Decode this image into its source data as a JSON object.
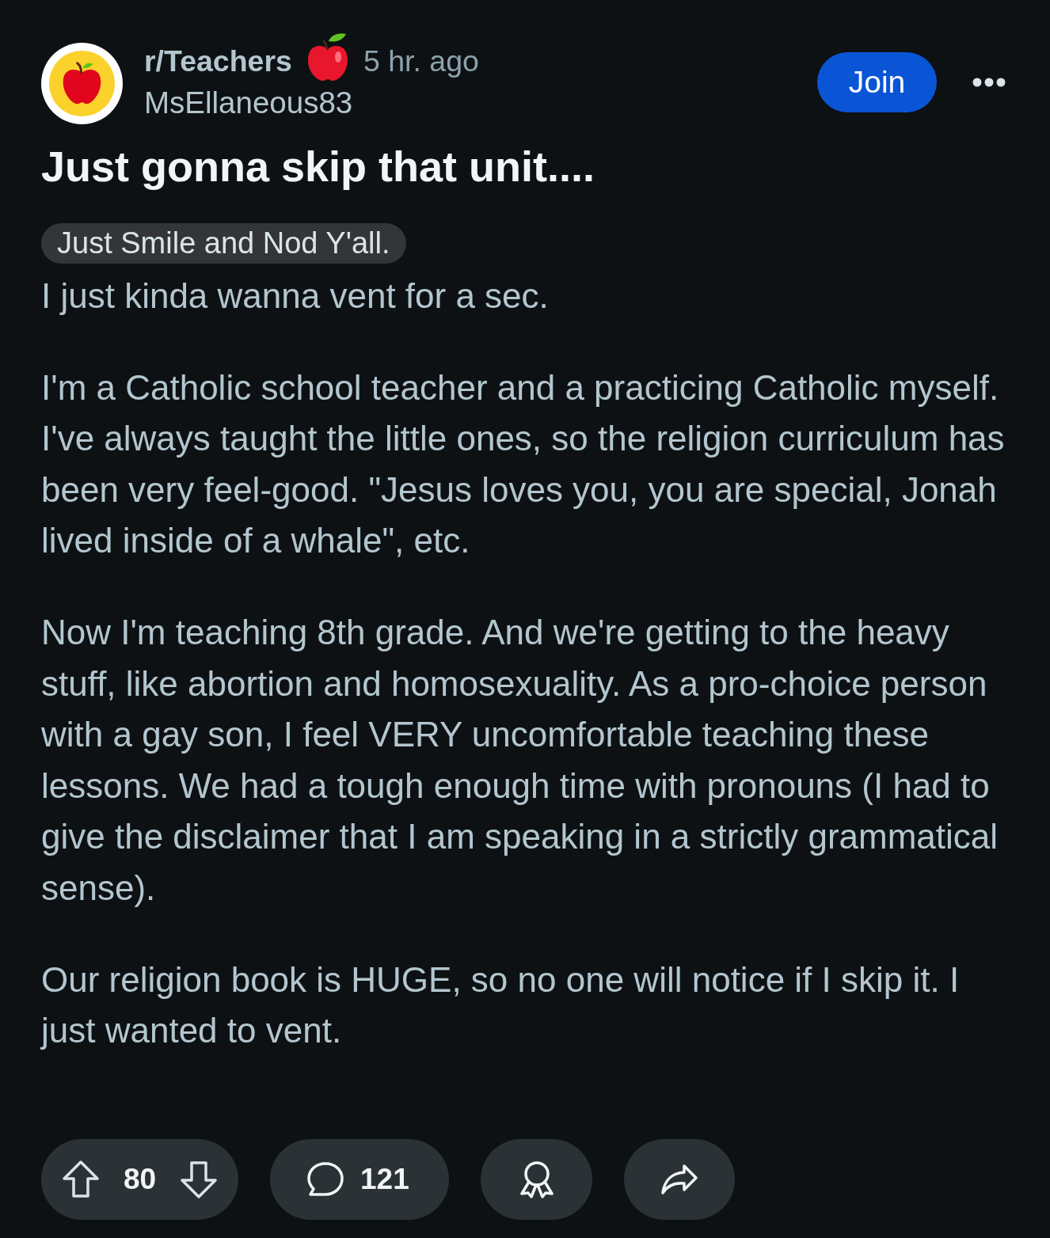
{
  "post": {
    "subreddit": "r/Teachers",
    "time": "5 hr. ago",
    "author": "MsEllaneous83",
    "join_button": "Join",
    "title": "Just gonna skip that unit....",
    "flair": "Just Smile and Nod Y'all.",
    "body": [
      "I just kinda wanna vent for a sec.",
      "I'm a Catholic school teacher and a practicing Catholic myself. I've always taught the little ones, so the religion curriculum has been very feel-good. \"Jesus loves you, you are special, Jonah lived inside of a whale\", etc.",
      "Now I'm teaching 8th grade. And we're getting to the heavy stuff, like abortion and homosexuality. As a pro-choice person with a gay son, I feel VERY uncomfortable teaching these lessons. We had a tough enough time with pronouns (I had to give the disclaimer that I am speaking in a strictly grammatical sense).",
      "Our religion book is HUGE, so no one will notice if I skip it. I just wanted to vent."
    ]
  },
  "actions": {
    "score": "80",
    "comments": "121"
  }
}
